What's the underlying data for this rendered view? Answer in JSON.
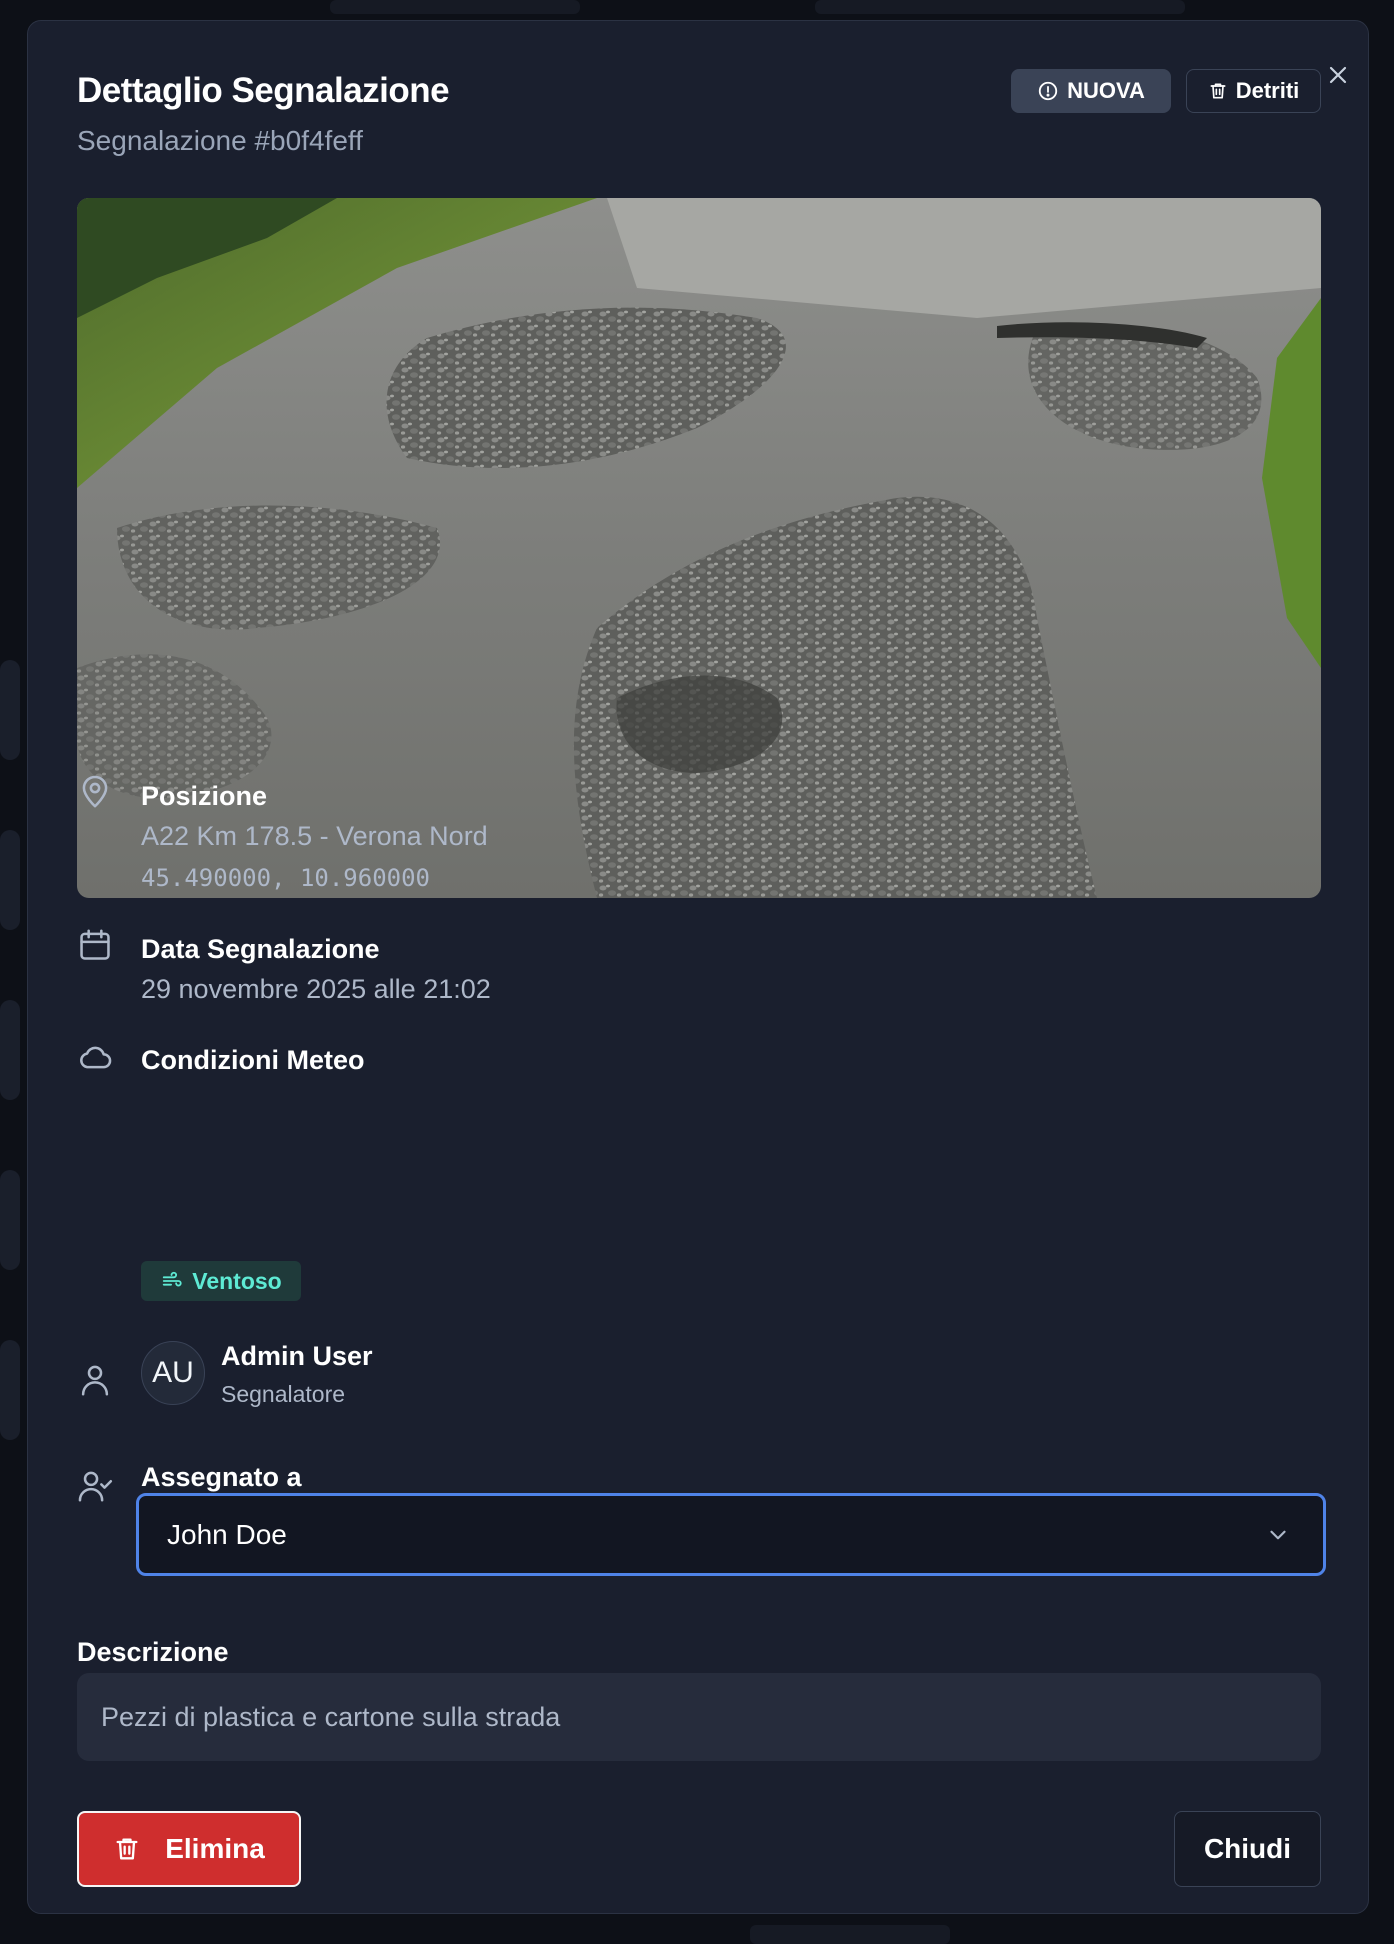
{
  "modal": {
    "title": "Dettaglio Segnalazione",
    "subtitle": "Segnalazione #b0f4feff",
    "status_badge": "NUOVA",
    "category_badge": "Detriti",
    "photo_icon": "pothole-road-photo"
  },
  "position": {
    "label": "Posizione",
    "address": "A22 Km 178.5 - Verona Nord",
    "coordinates": "45.490000, 10.960000"
  },
  "date": {
    "label": "Data Segnalazione",
    "value": "29 novembre 2025 alle 21:02"
  },
  "weather": {
    "label": "Condizioni Meteo",
    "value": "Ventoso"
  },
  "reporter": {
    "initials": "AU",
    "name": "Admin User",
    "role": "Segnalatore"
  },
  "assignment": {
    "label": "Assegnato a",
    "selected": "John Doe"
  },
  "description": {
    "label": "Descrizione",
    "text": "Pezzi di plastica e cartone sulla strada"
  },
  "actions": {
    "delete_label": "Elimina",
    "close_label": "Chiudi"
  },
  "colors": {
    "accent": "#4f83e8",
    "danger": "#cf2e2e",
    "weather": "#5eead4",
    "surface": "#1a1f2e"
  }
}
